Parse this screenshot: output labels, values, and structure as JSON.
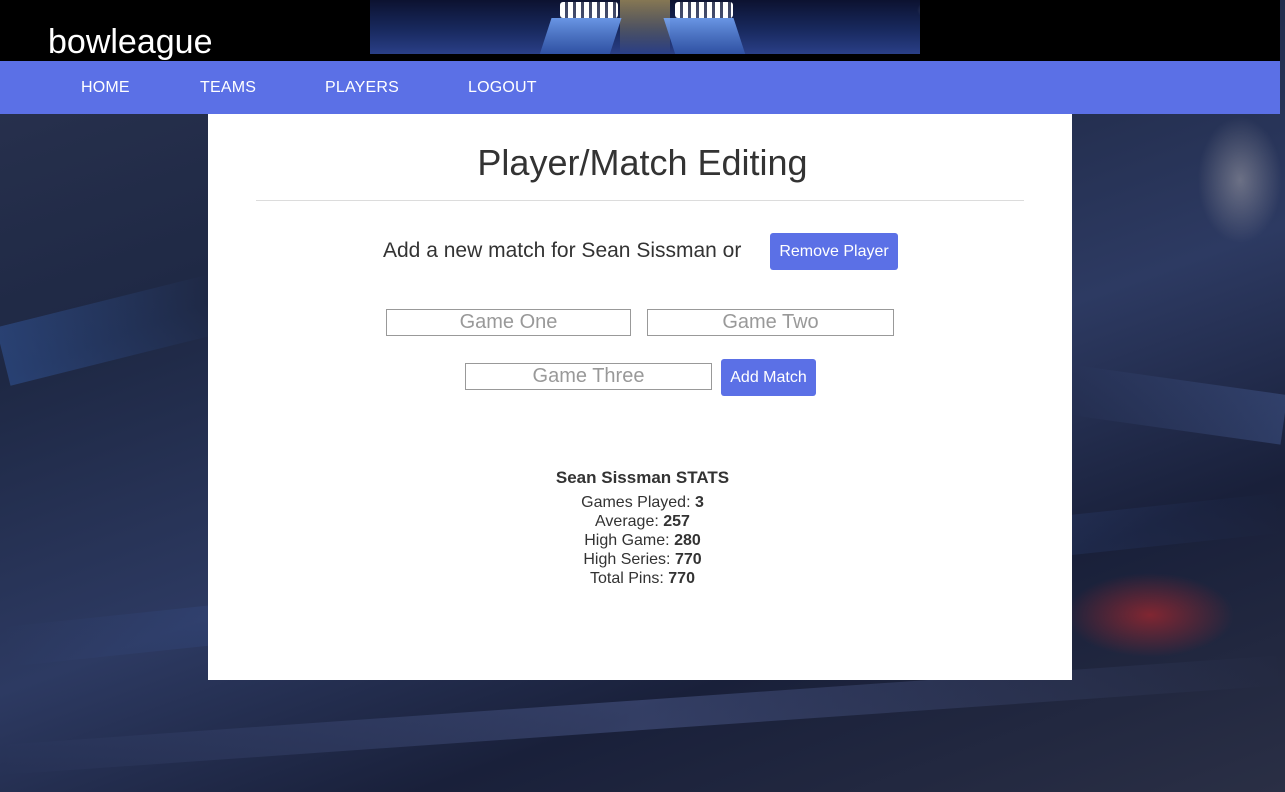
{
  "header": {
    "brand": "bowleague"
  },
  "nav": {
    "items": [
      "HOME",
      "TEAMS",
      "PLAYERS",
      "LOGOUT"
    ]
  },
  "page": {
    "title": "Player/Match Editing",
    "subheading": "Add a new match for Sean Sissman or",
    "remove_button": "Remove Player",
    "add_button": "Add Match"
  },
  "form": {
    "game_one_placeholder": "Game One",
    "game_two_placeholder": "Game Two",
    "game_three_placeholder": "Game Three",
    "game_one_value": "",
    "game_two_value": "",
    "game_three_value": ""
  },
  "stats": {
    "title": "Sean Sissman STATS",
    "rows": [
      {
        "label": "Games Played:",
        "value": "3"
      },
      {
        "label": "Average:",
        "value": "257"
      },
      {
        "label": "High Game:",
        "value": "280"
      },
      {
        "label": "High Series:",
        "value": "770"
      },
      {
        "label": "Total Pins:",
        "value": "770"
      }
    ]
  },
  "colors": {
    "accent": "#5b70e6",
    "topbar": "#000000",
    "panel": "#ffffff",
    "text": "#333333"
  }
}
